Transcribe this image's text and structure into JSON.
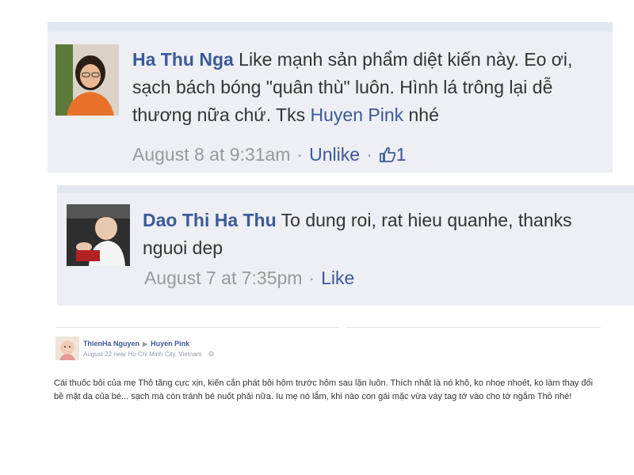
{
  "comments": [
    {
      "author": "Ha Thu Nga",
      "text_part1": " Like mạnh sản phẩm diệt kiến này. Eo ơi, sạch bách bóng \"quân thù\" luôn. Hình lá trông lại dễ thương nữa chứ. Tks ",
      "mention": "Huyen Pink",
      "text_part2": " nhé",
      "timestamp": "August 8 at 9:31am",
      "action": "Unlike",
      "likes": "1"
    },
    {
      "author": "Dao Thi Ha Thu",
      "text": " To dung roi, rat hieu quanhe, thanks nguoi dep",
      "timestamp": "August 7 at 7:35pm",
      "action": "Like"
    }
  ],
  "post": {
    "author": "ThienHa Nguyen",
    "target": "Huyen Pink",
    "location": "August 22 near Ho Chi Minh City, Vietnam",
    "body": "Cái thuốc bôi của mẹ Thỏ tăng cực xịn, kiến cắn phát bôi hôm trước hôm sau lặn luôn. Thích nhất là nó khô, ko nhoe nhoét, ko làm thay đổi bề mặt da của bé... sạch mà còn tránh bé nuốt phải nữa. Iu mẹ nó lắm, khi nào con gái mặc vừa váy tag tớ vào cho tớ ngắm Thỏ nhé!"
  },
  "colors": {
    "link": "#3b5998",
    "panel": "#edeff4",
    "meta": "#999999"
  }
}
